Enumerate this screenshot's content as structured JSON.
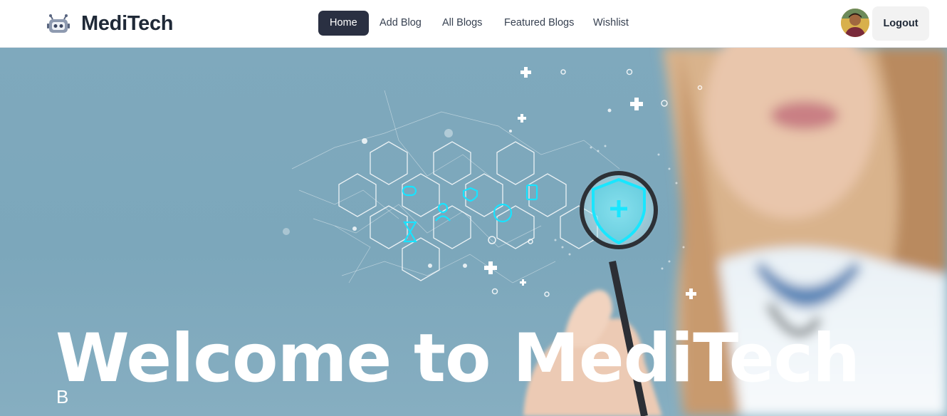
{
  "header": {
    "brand": "MediTech",
    "logo_icon": "robot-icon",
    "nav": [
      {
        "label": "Home",
        "active": true
      },
      {
        "label": "Add Blog",
        "active": false
      },
      {
        "label": "All Blogs",
        "active": false
      },
      {
        "label": "Featured Blogs",
        "active": false
      },
      {
        "label": "Wishlist",
        "active": false
      }
    ],
    "avatar_icon": "user-avatar",
    "logout_label": "Logout",
    "accent_color": "#2a3042"
  },
  "hero": {
    "title": "Welcome to MediTech",
    "subtitle": "B",
    "image_description_icon": "medical-shield-icon",
    "background_color": "#7fa9bd"
  }
}
